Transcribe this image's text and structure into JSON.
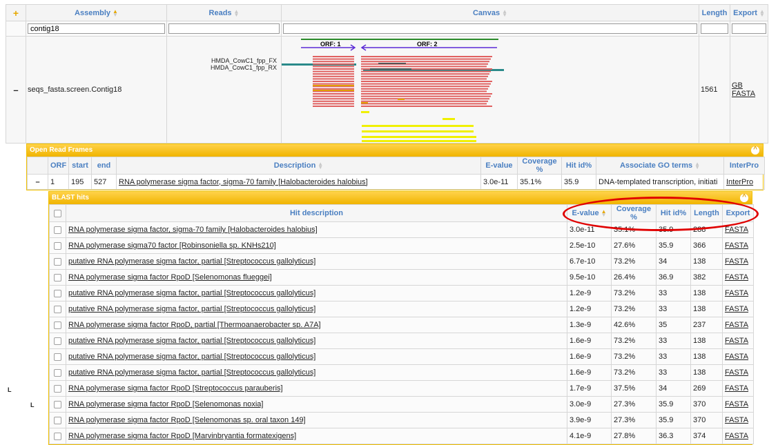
{
  "toolbar": {
    "add_icon": "plus-icon",
    "add_symbol": "+"
  },
  "columns": {
    "assembly": "Assembly",
    "reads": "Reads",
    "canvas": "Canvas",
    "length": "Length",
    "export": "Export"
  },
  "filters": {
    "assembly_value": "contig18"
  },
  "contig": {
    "collapse_symbol": "–",
    "name": "seqs_fasta.screen.Contig18",
    "read_labels": [
      "HMDA_CowC1_fpp_FX",
      "HMDA_CowC1_fpp_RX"
    ],
    "orf_labels": [
      "ORF: 1",
      "ORF: 2"
    ],
    "length": "1561",
    "export_links": [
      "GB",
      "FASTA"
    ]
  },
  "orf_panel": {
    "title": "Open Read Frames",
    "collapse_symbol": "^",
    "headers": [
      "ORF",
      "start",
      "end",
      "Description",
      "E-value",
      "Coverage %",
      "Hit id%",
      "Associate GO terms",
      "InterPro"
    ],
    "row": {
      "expand_symbol": "–",
      "orf": "1",
      "start": "195",
      "end": "527",
      "description": "RNA polymerase sigma factor, sigma-70 family [Halobacteroides halobius]",
      "evalue": "3.0e-11",
      "coverage": "35.1%",
      "hit_id": "35.9",
      "go_terms": "DNA-templated transcription, initiati",
      "interpro": "InterPro"
    }
  },
  "blast_panel": {
    "title": "BLAST hits",
    "collapse_symbol": "^",
    "headers": [
      "Hit description",
      "E-value",
      "Coverage %",
      "Hit id%",
      "Length",
      "Export"
    ],
    "rows": [
      {
        "desc": "RNA polymerase sigma factor, sigma-70 family [Halobacteroides halobius]",
        "evalue": "3.0e-11",
        "coverage": "35.1%",
        "hit_id": "35.9",
        "length": "288",
        "export": "FASTA"
      },
      {
        "desc": "RNA polymerase sigma70 factor [Robinsoniella sp. KNHs210]",
        "evalue": "2.5e-10",
        "coverage": "27.6%",
        "hit_id": "35.9",
        "length": "366",
        "export": "FASTA"
      },
      {
        "desc": "putative RNA polymerase sigma factor, partial [Streptococcus gallolyticus]",
        "evalue": "6.7e-10",
        "coverage": "73.2%",
        "hit_id": "34",
        "length": "138",
        "export": "FASTA"
      },
      {
        "desc": "RNA polymerase sigma factor RpoD [Selenomonas flueggei]",
        "evalue": "9.5e-10",
        "coverage": "26.4%",
        "hit_id": "36.9",
        "length": "382",
        "export": "FASTA"
      },
      {
        "desc": "putative RNA polymerase sigma factor, partial [Streptococcus gallolyticus]",
        "evalue": "1.2e-9",
        "coverage": "73.2%",
        "hit_id": "33",
        "length": "138",
        "export": "FASTA"
      },
      {
        "desc": "putative RNA polymerase sigma factor, partial [Streptococcus gallolyticus]",
        "evalue": "1.2e-9",
        "coverage": "73.2%",
        "hit_id": "33",
        "length": "138",
        "export": "FASTA"
      },
      {
        "desc": "RNA polymerase sigma factor RpoD, partial [Thermoanaerobacter sp. A7A]",
        "evalue": "1.3e-9",
        "coverage": "42.6%",
        "hit_id": "35",
        "length": "237",
        "export": "FASTA"
      },
      {
        "desc": "putative RNA polymerase sigma factor, partial [Streptococcus gallolyticus]",
        "evalue": "1.6e-9",
        "coverage": "73.2%",
        "hit_id": "33",
        "length": "138",
        "export": "FASTA"
      },
      {
        "desc": "putative RNA polymerase sigma factor, partial [Streptococcus gallolyticus]",
        "evalue": "1.6e-9",
        "coverage": "73.2%",
        "hit_id": "33",
        "length": "138",
        "export": "FASTA"
      },
      {
        "desc": "putative RNA polymerase sigma factor, partial [Streptococcus gallolyticus]",
        "evalue": "1.6e-9",
        "coverage": "73.2%",
        "hit_id": "33",
        "length": "138",
        "export": "FASTA"
      },
      {
        "desc": "RNA polymerase sigma factor RpoD [Streptococcus parauberis]",
        "evalue": "1.7e-9",
        "coverage": "37.5%",
        "hit_id": "34",
        "length": "269",
        "export": "FASTA"
      },
      {
        "desc": "RNA polymerase sigma factor RpoD [Selenomonas noxia]",
        "evalue": "3.0e-9",
        "coverage": "27.3%",
        "hit_id": "35.9",
        "length": "370",
        "export": "FASTA"
      },
      {
        "desc": "RNA polymerase sigma factor RpoD [Selenomonas sp. oral taxon 149]",
        "evalue": "3.9e-9",
        "coverage": "27.3%",
        "hit_id": "35.9",
        "length": "370",
        "export": "FASTA"
      },
      {
        "desc": "RNA polymerase sigma factor RpoD [Marvinbryantia formatexigens]",
        "evalue": "4.1e-9",
        "coverage": "27.8%",
        "hit_id": "36.3",
        "length": "374",
        "export": "FASTA"
      }
    ]
  },
  "colors": {
    "header_text": "#4a7fc1",
    "panel": "#f0b400",
    "annotation": "#e00000",
    "read_red": "#e06060",
    "read_yellow": "#f0f000",
    "teal": "#2a8a8a",
    "orf_purple": "#5a2ad6",
    "orf_green": "#2a8a2a"
  }
}
